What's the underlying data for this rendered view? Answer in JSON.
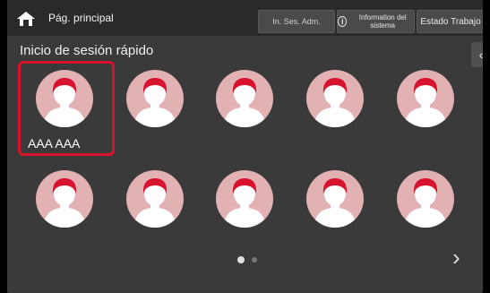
{
  "header": {
    "title": "Pág. principal",
    "login_admin_button": "In. Ses. Adm.",
    "system_info_button": "Information del sistema",
    "job_status_button": "Estado Trabajo"
  },
  "quick_login": {
    "title": "Inicio de sesión rápido",
    "users": [
      {
        "label": "AAA AAA",
        "selected": true
      },
      {
        "label": ""
      },
      {
        "label": ""
      },
      {
        "label": ""
      },
      {
        "label": ""
      },
      {
        "label": ""
      },
      {
        "label": ""
      },
      {
        "label": ""
      },
      {
        "label": ""
      },
      {
        "label": ""
      }
    ]
  },
  "pagination": {
    "current_page": 1,
    "total_pages": 2
  },
  "icons": [
    "home-icon",
    "info-icon",
    "collapse-panel-icon",
    "user-avatar-icon",
    "next-page-icon"
  ],
  "colors": {
    "accent": "#d8132e",
    "avatar_bg": "#e2b1b4",
    "avatar_hair": "#d8132e",
    "background": "#3a3a3a"
  }
}
